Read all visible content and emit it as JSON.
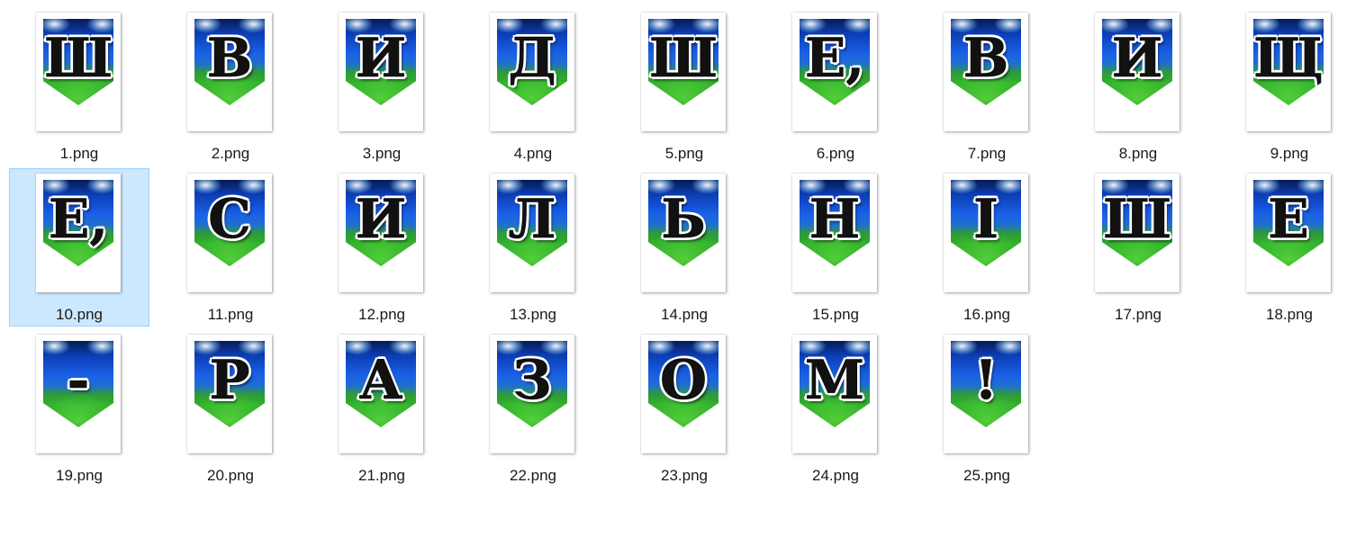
{
  "selected_index": 9,
  "files": [
    {
      "name": "1.png",
      "glyph": "Ш"
    },
    {
      "name": "2.png",
      "glyph": "В"
    },
    {
      "name": "3.png",
      "glyph": "И"
    },
    {
      "name": "4.png",
      "glyph": "Д"
    },
    {
      "name": "5.png",
      "glyph": "Ш"
    },
    {
      "name": "6.png",
      "glyph": "Е,"
    },
    {
      "name": "7.png",
      "glyph": "В"
    },
    {
      "name": "8.png",
      "glyph": "И"
    },
    {
      "name": "9.png",
      "glyph": "Щ"
    },
    {
      "name": "10.png",
      "glyph": "Е,"
    },
    {
      "name": "11.png",
      "glyph": "С"
    },
    {
      "name": "12.png",
      "glyph": "И"
    },
    {
      "name": "13.png",
      "glyph": "Л"
    },
    {
      "name": "14.png",
      "glyph": "Ь"
    },
    {
      "name": "15.png",
      "glyph": "Н"
    },
    {
      "name": "16.png",
      "glyph": "І"
    },
    {
      "name": "17.png",
      "glyph": "Ш"
    },
    {
      "name": "18.png",
      "glyph": "Е"
    },
    {
      "name": "19.png",
      "glyph": "-"
    },
    {
      "name": "20.png",
      "glyph": "Р"
    },
    {
      "name": "21.png",
      "glyph": "А"
    },
    {
      "name": "22.png",
      "glyph": "З"
    },
    {
      "name": "23.png",
      "glyph": "О"
    },
    {
      "name": "24.png",
      "glyph": "М"
    },
    {
      "name": "25.png",
      "glyph": "!"
    }
  ]
}
